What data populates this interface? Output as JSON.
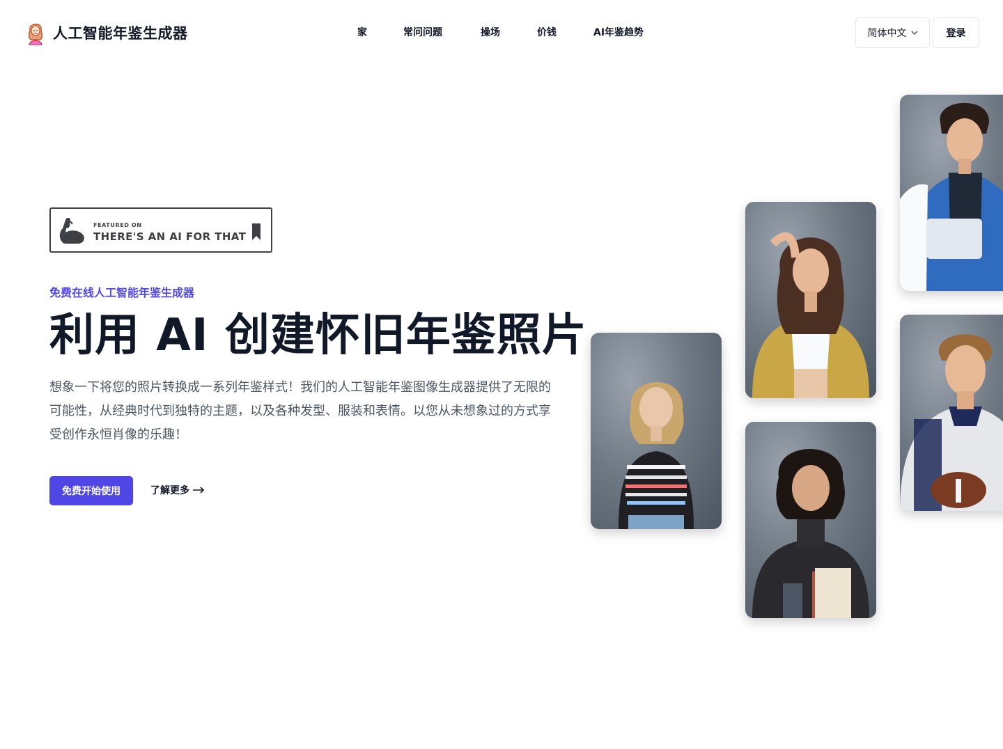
{
  "header": {
    "logo_text": "人工智能年鉴生成器",
    "logo_icon": "girl-portrait-logo-icon",
    "nav": [
      {
        "label": "家"
      },
      {
        "label": "常问问题"
      },
      {
        "label": "操场"
      },
      {
        "label": "价钱"
      },
      {
        "label": "AI年鉴趋势"
      }
    ],
    "language": "简体中文",
    "language_icon": "chevron-down-icon",
    "login_label": "登录"
  },
  "badge": {
    "small_text": "FEATURED ON",
    "big_text": "THERE'S AN AI FOR THAT",
    "icon_left": "flexed-arm-icon",
    "icon_right": "bookmark-icon"
  },
  "hero": {
    "eyebrow": "免费在线人工智能年鉴生成器",
    "title": "利用 AI 创建怀旧年鉴照片",
    "description": "想象一下将您的照片转换成一系列年鉴样式！我们的人工智能年鉴图像生成器提供了无限的可能性，从经典时代到独特的主题，以及各种发型、服装和表情。以您从未想象过的方式享受创作永恒肖像的乐趣！",
    "cta_label": "免费开始使用",
    "more_label": "了解更多",
    "more_icon": "arrow-right-icon"
  },
  "colors": {
    "accent": "#4f46e5",
    "text": "#111827",
    "muted": "#4b5563",
    "border": "#e5e7eb"
  }
}
